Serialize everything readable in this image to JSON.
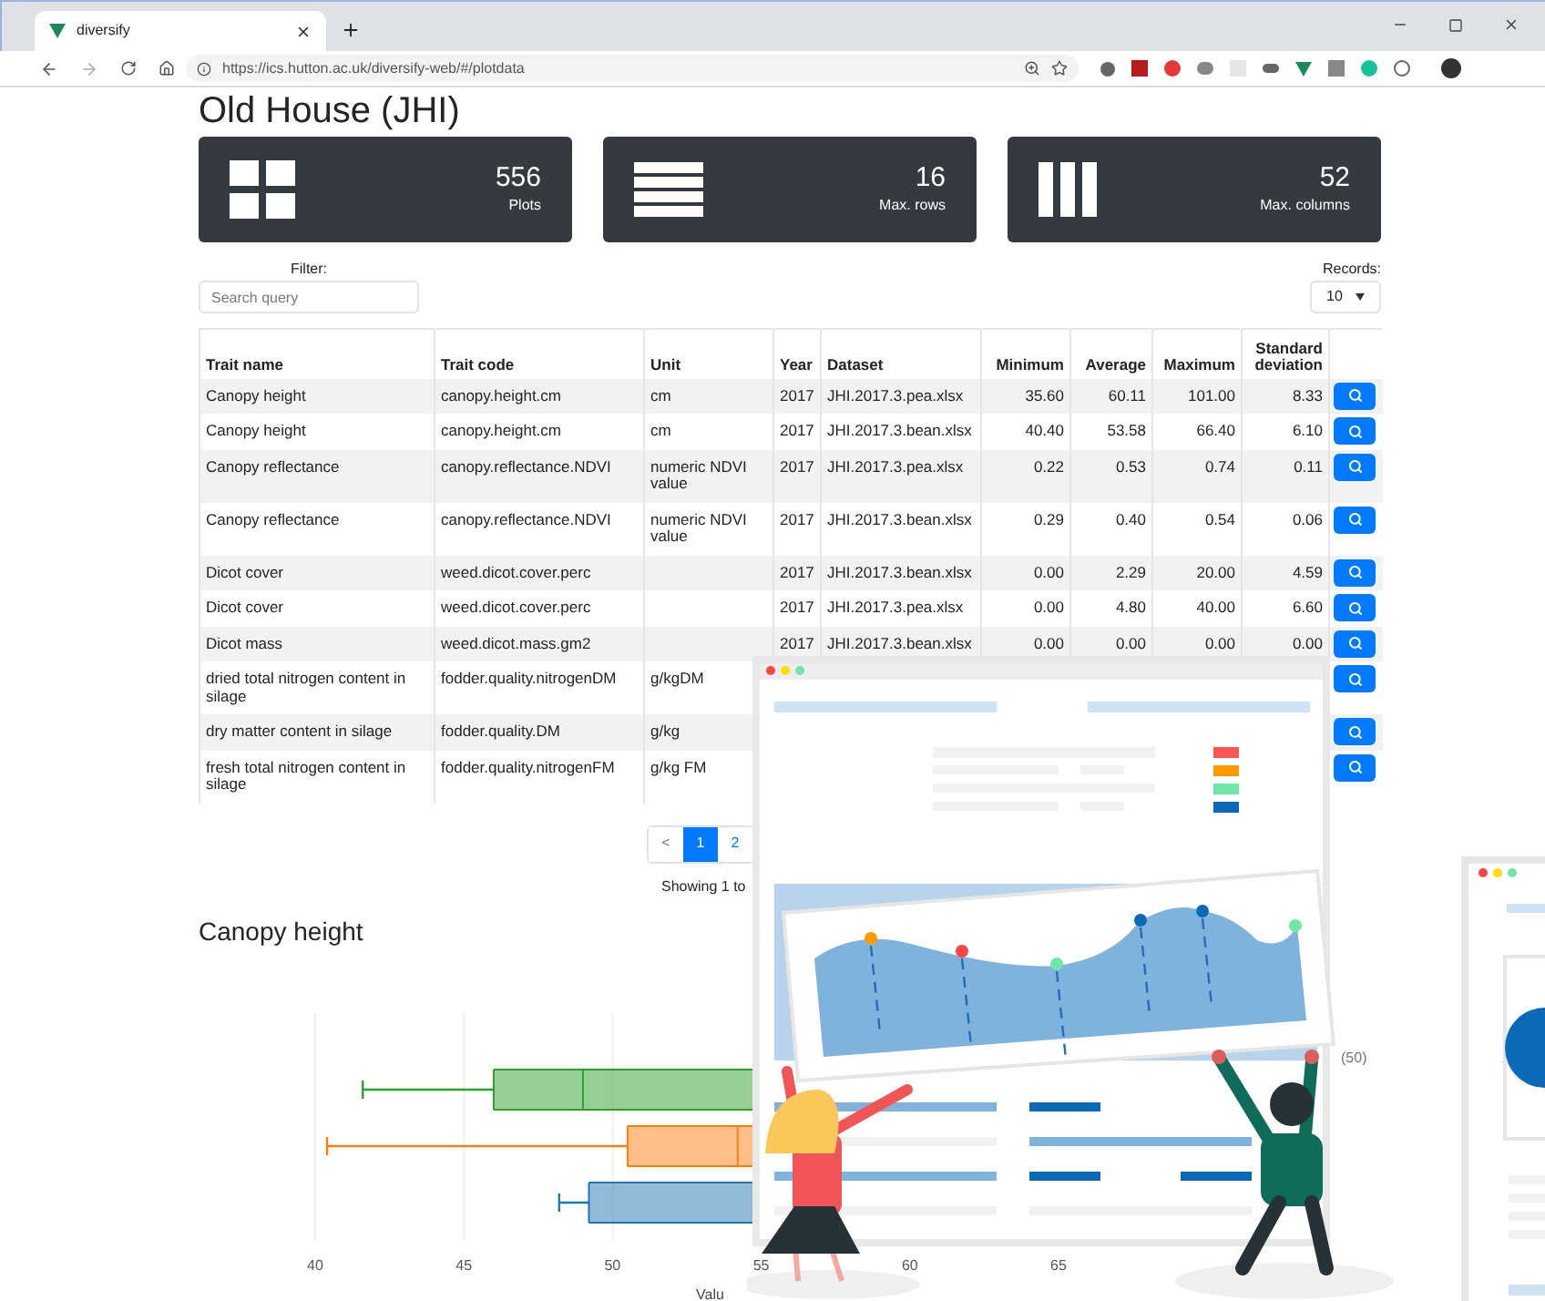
{
  "browser": {
    "tab_title": "diversify",
    "url": "https://ics.hutton.ac.uk/diversify-web/#/plotdata"
  },
  "title": "Old House (JHI)",
  "stats": [
    {
      "kind": "grid",
      "value": "556",
      "label": "Plots"
    },
    {
      "kind": "rows",
      "value": "16",
      "label": "Max. rows"
    },
    {
      "kind": "columns",
      "value": "52",
      "label": "Max. columns"
    }
  ],
  "filter": {
    "label": "Filter:",
    "placeholder": "Search query"
  },
  "records": {
    "label": "Records:",
    "value": "10"
  },
  "table": {
    "columns": [
      "Trait name",
      "Trait code",
      "Unit",
      "Year",
      "Dataset",
      "Minimum",
      "Average",
      "Maximum",
      "Standard deviation"
    ],
    "rows": [
      [
        "Canopy height",
        "canopy.height.cm",
        "cm",
        "2017",
        "JHI.2017.3.pea.xlsx",
        "35.60",
        "60.11",
        "101.00",
        "8.33"
      ],
      [
        "Canopy height",
        "canopy.height.cm",
        "cm",
        "2017",
        "JHI.2017.3.bean.xlsx",
        "40.40",
        "53.58",
        "66.40",
        "6.10"
      ],
      [
        "Canopy reflectance",
        "canopy.reflectance.NDVI",
        "numeric NDVI value",
        "2017",
        "JHI.2017.3.pea.xlsx",
        "0.22",
        "0.53",
        "0.74",
        "0.11"
      ],
      [
        "Canopy reflectance",
        "canopy.reflectance.NDVI",
        "numeric NDVI value",
        "2017",
        "JHI.2017.3.bean.xlsx",
        "0.29",
        "0.40",
        "0.54",
        "0.06"
      ],
      [
        "Dicot cover",
        "weed.dicot.cover.perc",
        "",
        "2017",
        "JHI.2017.3.bean.xlsx",
        "0.00",
        "2.29",
        "20.00",
        "4.59"
      ],
      [
        "Dicot cover",
        "weed.dicot.cover.perc",
        "",
        "2017",
        "JHI.2017.3.pea.xlsx",
        "0.00",
        "4.80",
        "40.00",
        "6.60"
      ],
      [
        "Dicot mass",
        "weed.dicot.mass.gm2",
        "",
        "2017",
        "JHI.2017.3.bean.xlsx",
        "0.00",
        "0.00",
        "0.00",
        "0.00"
      ],
      [
        "dried total nitrogen content in silage",
        "fodder.quality.nitrogenDM",
        "g/kgDM"
      ],
      [
        "dry matter content in silage",
        "fodder.quality.DM",
        "g/kg"
      ],
      [
        "fresh total nitrogen content in silage",
        "fodder.quality.nitrogenFM",
        "g/kg FM"
      ]
    ]
  },
  "pagination": [
    {
      "label": "<",
      "selected": false
    },
    {
      "label": "1",
      "selected": true
    },
    {
      "label": "2",
      "selected": false
    }
  ],
  "showing": "Showing 1 to",
  "plot": {
    "title": "Canopy height",
    "xticks": [
      "40",
      "45",
      "50",
      "55",
      "60",
      "65"
    ],
    "xlabel": "Valu",
    "legend_fragment": "(50)"
  }
}
